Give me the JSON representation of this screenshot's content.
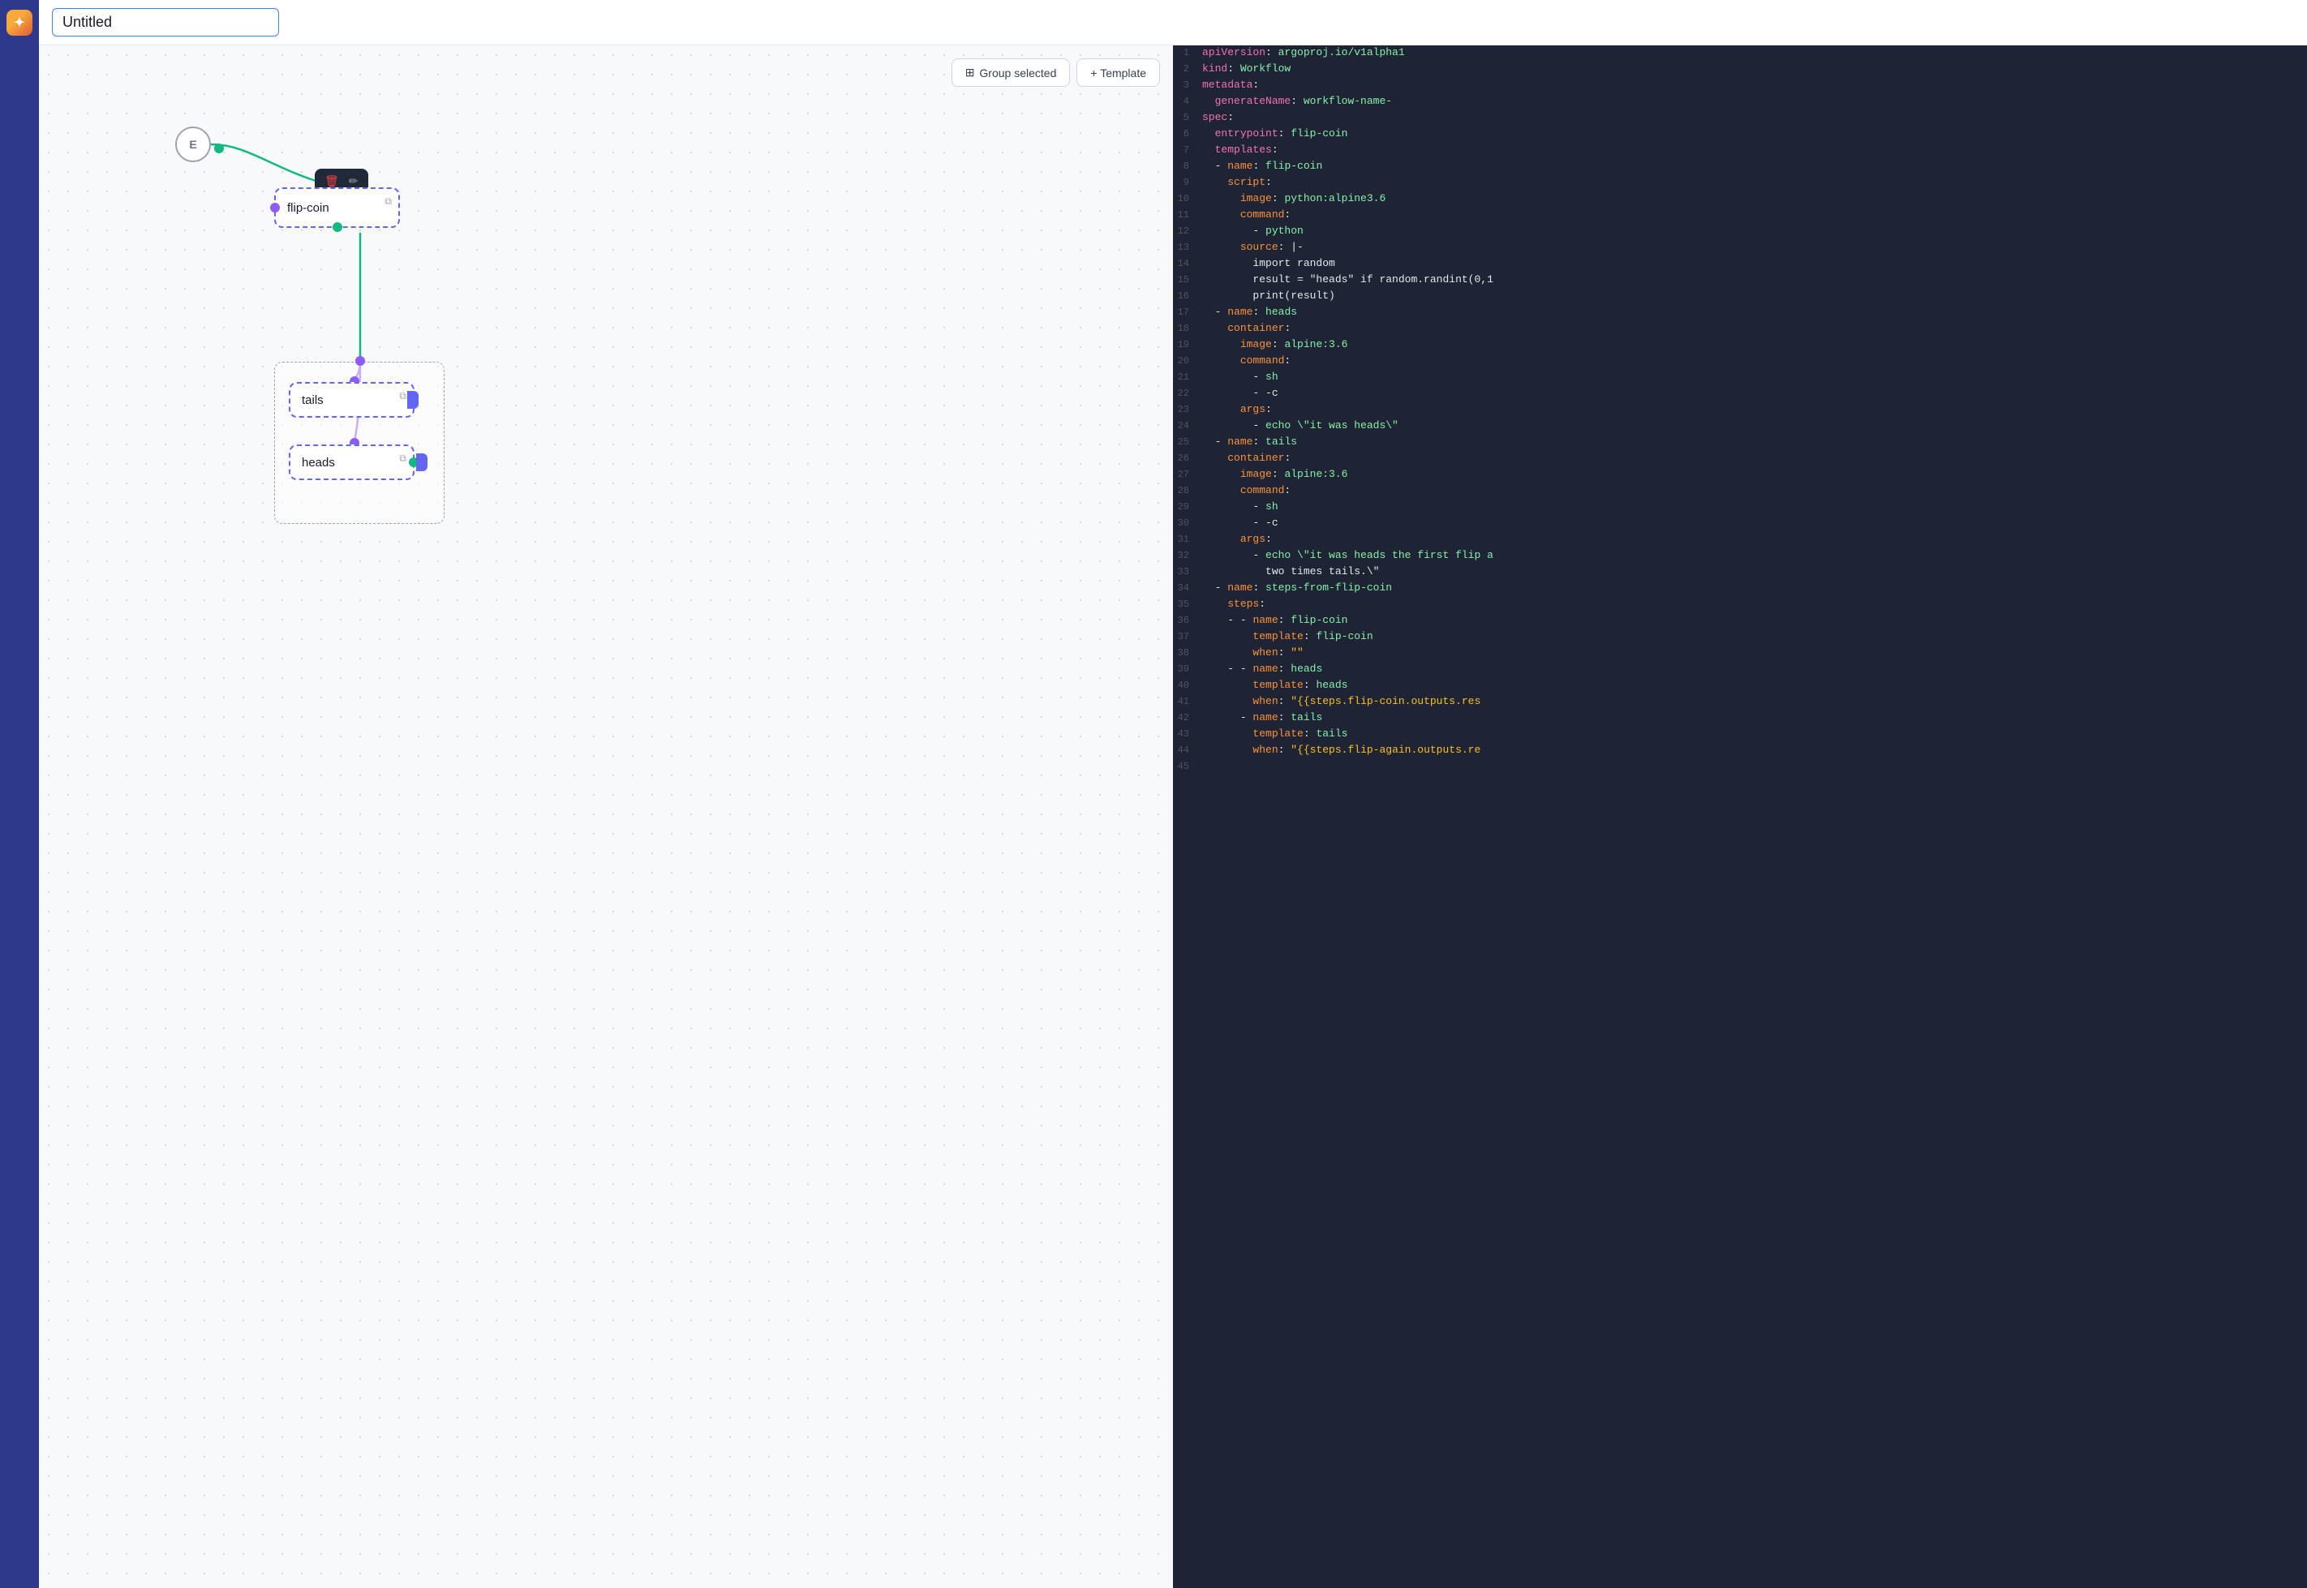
{
  "sidebar": {
    "logo": "✦"
  },
  "header": {
    "title": "Untitled",
    "title_placeholder": "Untitled"
  },
  "toolbar": {
    "group_selected_label": "Group selected",
    "template_label": "+ Template"
  },
  "canvas": {
    "entry_label": "E",
    "flip_coin_label": "flip-coin",
    "tails_label": "tails",
    "heads_label": "heads"
  },
  "code": {
    "lines": [
      {
        "num": 1,
        "content": "apiVersion: argoproj.io/v1alpha1"
      },
      {
        "num": 2,
        "content": "kind: Workflow"
      },
      {
        "num": 3,
        "content": "metadata:"
      },
      {
        "num": 4,
        "content": "  generateName: workflow-name-"
      },
      {
        "num": 5,
        "content": "spec:"
      },
      {
        "num": 6,
        "content": "  entrypoint: flip-coin"
      },
      {
        "num": 7,
        "content": "  templates:"
      },
      {
        "num": 8,
        "content": "  - name: flip-coin"
      },
      {
        "num": 9,
        "content": "    script:"
      },
      {
        "num": 10,
        "content": "      image: python:alpine3.6"
      },
      {
        "num": 11,
        "content": "      command:"
      },
      {
        "num": 12,
        "content": "        - python"
      },
      {
        "num": 13,
        "content": "      source: |-"
      },
      {
        "num": 14,
        "content": "        import random"
      },
      {
        "num": 15,
        "content": "        result = \"heads\" if random.randint(0,1"
      },
      {
        "num": 16,
        "content": "        print(result)"
      },
      {
        "num": 17,
        "content": "  - name: heads"
      },
      {
        "num": 18,
        "content": "    container:"
      },
      {
        "num": 19,
        "content": "      image: alpine:3.6"
      },
      {
        "num": 20,
        "content": "      command:"
      },
      {
        "num": 21,
        "content": "        - sh"
      },
      {
        "num": 22,
        "content": "        - -c"
      },
      {
        "num": 23,
        "content": "      args:"
      },
      {
        "num": 24,
        "content": "        - echo \\\"it was heads\\\""
      },
      {
        "num": 25,
        "content": "  - name: tails"
      },
      {
        "num": 26,
        "content": "    container:"
      },
      {
        "num": 27,
        "content": "      image: alpine:3.6"
      },
      {
        "num": 28,
        "content": "      command:"
      },
      {
        "num": 29,
        "content": "        - sh"
      },
      {
        "num": 30,
        "content": "        - -c"
      },
      {
        "num": 31,
        "content": "      args:"
      },
      {
        "num": 32,
        "content": "        - echo \\\"it was heads the first flip a"
      },
      {
        "num": 33,
        "content": "          two times tails.\\\""
      },
      {
        "num": 34,
        "content": "  - name: steps-from-flip-coin"
      },
      {
        "num": 35,
        "content": "    steps:"
      },
      {
        "num": 36,
        "content": "    - - name: flip-coin"
      },
      {
        "num": 37,
        "content": "        template: flip-coin"
      },
      {
        "num": 38,
        "content": "        when: \"\""
      },
      {
        "num": 39,
        "content": "    - - name: heads"
      },
      {
        "num": 40,
        "content": "        template: heads"
      },
      {
        "num": 41,
        "content": "        when: \"{{steps.flip-coin.outputs.res"
      },
      {
        "num": 42,
        "content": "      - name: tails"
      },
      {
        "num": 43,
        "content": "        template: tails"
      },
      {
        "num": 44,
        "content": "        when: \"{{steps.flip-again.outputs.re"
      },
      {
        "num": 45,
        "content": ""
      }
    ]
  }
}
